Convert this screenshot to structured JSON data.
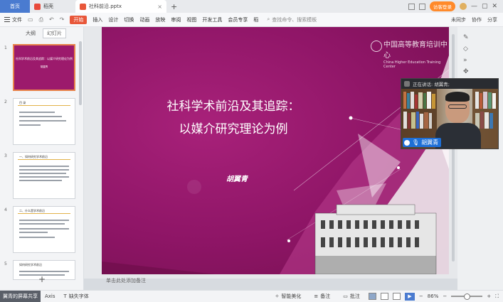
{
  "tabs": {
    "home": "首页",
    "doc1": "稻壳",
    "active": "社科前沿.pptx"
  },
  "window": {
    "login_label": "访客登录"
  },
  "toolbar": {
    "file_menu": "文件",
    "menus": [
      "开始",
      "插入",
      "设计",
      "切换",
      "动画",
      "放映",
      "审阅",
      "视图",
      "开发工具",
      "会员专享",
      "稻"
    ],
    "search_placeholder": "查找命令、搜索模板",
    "right": [
      "未同步",
      "协作",
      "分享"
    ]
  },
  "left_panel": {
    "tabs": [
      "大纲",
      "幻灯片"
    ],
    "slides": [
      {
        "num": "1",
        "title": "社科学术前沿及其追踪：以媒介研究理论为例",
        "author": "胡翼青"
      },
      {
        "num": "2",
        "title": "目 录"
      },
      {
        "num": "3",
        "title": "一、如何研究学术前沿"
      },
      {
        "num": "4",
        "title": "二、什么是学术前沿"
      },
      {
        "num": "5",
        "title": "如何研究学术前沿"
      }
    ]
  },
  "slide": {
    "title_line1": "社科学术前沿及其追踪：",
    "title_line2": "以媒介研究理论为例",
    "author": "胡翼青",
    "logo_cn": "中国高等教育培训中心",
    "logo_en": "China Higher Education Training Center"
  },
  "notes_placeholder": "单击此处添加备注",
  "video": {
    "speaking_label": "正在讲话: 胡翼青;",
    "participant_name": "胡翼青"
  },
  "status": {
    "share_label": "翼青的屏幕共享",
    "left_item": "Axis",
    "missing_font": "缺失字体",
    "smart_beautify": "智能美化",
    "notes": "备注",
    "comments": "批注",
    "zoom": "86%"
  }
}
